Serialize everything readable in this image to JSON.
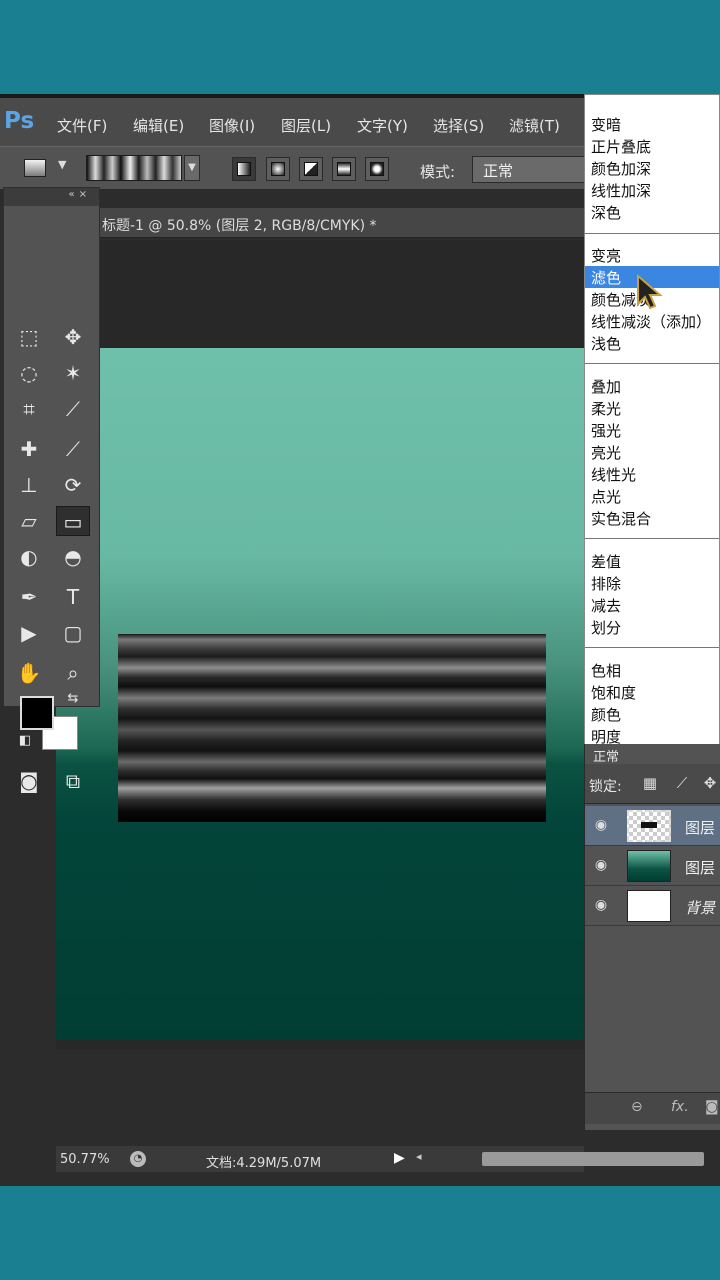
{
  "app": {
    "logo": "Ps",
    "menu": [
      "文件(F)",
      "编辑(E)",
      "图像(I)",
      "图层(L)",
      "文字(Y)",
      "选择(S)",
      "滤镜(T)"
    ]
  },
  "options_bar": {
    "mode_label": "模式:",
    "mode_value": "正常"
  },
  "document": {
    "tab_title": "标题-1 @ 50.8% (图层 2, RGB/8/CMYK) *"
  },
  "status_bar": {
    "zoom": "50.77%",
    "doc_size": "文档:4.29M/5.07M"
  },
  "blend_menu": {
    "items": [
      "变暗",
      "正片叠底",
      "颜色加深",
      "线性加深",
      "深色",
      "变亮",
      "滤色",
      "颜色减淡",
      "线性减淡（添加）",
      "浅色",
      "叠加",
      "柔光",
      "强光",
      "亮光",
      "线性光",
      "点光",
      "实色混合",
      "差值",
      "排除",
      "减去",
      "划分",
      "色相",
      "饱和度",
      "颜色",
      "明度"
    ],
    "selected": "滤色"
  },
  "layers_panel": {
    "mode_text": "正常",
    "lock_label": "锁定:",
    "layers": [
      {
        "name": "图层"
      },
      {
        "name": "图层"
      },
      {
        "name": "背景"
      }
    ]
  },
  "colors": {
    "foreground": "#000000",
    "background": "#ffffff",
    "selection": "#3b86e0"
  }
}
